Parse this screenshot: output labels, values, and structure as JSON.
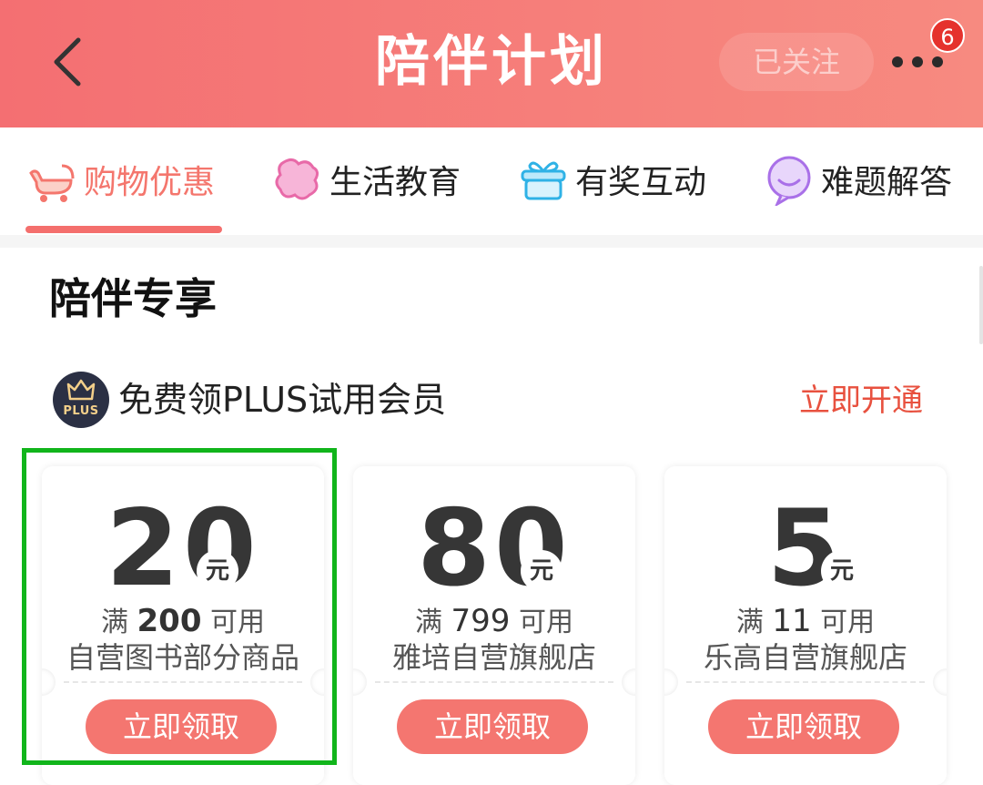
{
  "header": {
    "title": "陪伴计划",
    "follow_label": "已关注",
    "badge_count": "6",
    "back_icon": "chevron-left-icon",
    "more_icon": "more-dots-icon"
  },
  "tabs": [
    {
      "label": "购物优惠",
      "icon": "stroller-icon",
      "active": true
    },
    {
      "label": "生活教育",
      "icon": "puzzle-icon",
      "active": false
    },
    {
      "label": "有奖互动",
      "icon": "gift-icon",
      "active": false
    },
    {
      "label": "难题解答",
      "icon": "chat-bubble-icon",
      "active": false
    }
  ],
  "section": {
    "title": "陪伴专享"
  },
  "plus": {
    "badge_text": "PLUS",
    "text": "免费领PLUS试用会员",
    "action": "立即开通"
  },
  "coupons": [
    {
      "amount": "20",
      "unit": "元",
      "cond_prefix": "满",
      "cond_value": "200",
      "cond_suffix": "可用",
      "scope": "自营图书部分商品",
      "button": "立即领取"
    },
    {
      "amount": "80",
      "unit": "元",
      "cond_prefix": "满",
      "cond_value": "799",
      "cond_suffix": "可用",
      "scope": "雅培自营旗舰店",
      "button": "立即领取"
    },
    {
      "amount": "5",
      "unit": "元",
      "cond_prefix": "满",
      "cond_value": "11",
      "cond_suffix": "可用",
      "scope": "乐高自营旗舰店",
      "button": "立即领取"
    }
  ],
  "colors": {
    "header_bg": "#f46f72",
    "accent": "#f47670",
    "link": "#e8513f",
    "highlight": "#11b51b"
  }
}
